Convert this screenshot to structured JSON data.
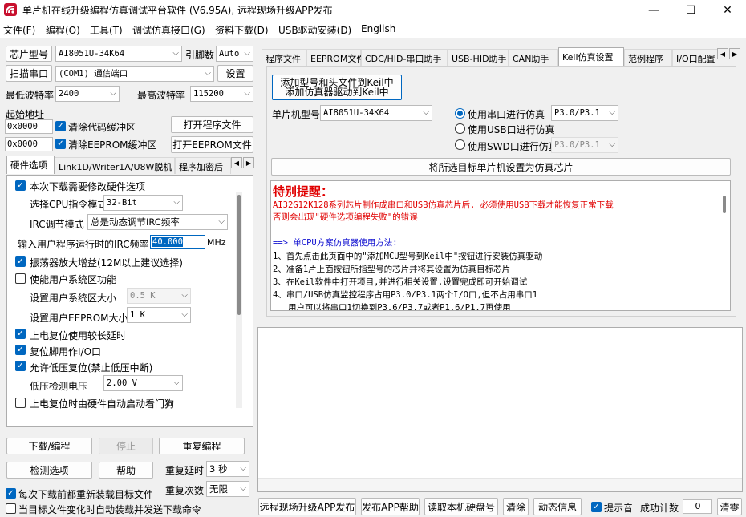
{
  "window": {
    "title": "单片机在线升级编程仿真调试平台软件 (V6.95A), 远程现场升级APP发布",
    "min": "—",
    "max": "☐",
    "close": "✕"
  },
  "menu": [
    "文件(F)",
    "编程(O)",
    "工具(T)",
    "调试仿真接口(G)",
    "资料下载(D)",
    "USB驱动安装(D)",
    "English"
  ],
  "left": {
    "chip_label": "芯片型号",
    "chip_value": "AI8051U-34K64",
    "lead_label": "引脚数",
    "lead_value": "Auto",
    "scan_button": "扫描串口",
    "port_value": "(COM1) 通信端口",
    "settings_button": "设置",
    "min_baud_label": "最低波特率",
    "min_baud_value": "2400",
    "max_baud_label": "最高波特率",
    "max_baud_value": "115200",
    "start_addr_label": "起始地址",
    "addr1": "0x0000",
    "addr2": "0x0000",
    "clear_code_label": "清除代码缓冲区",
    "clear_eeprom_label": "清除EEPROM缓冲区",
    "open_prog_button": "打开程序文件",
    "open_eeprom_button": "打开EEPROM文件",
    "tabs": [
      "硬件选项",
      "Link1D/Writer1A/U8W脱机",
      "程序加密后"
    ],
    "hw": {
      "opt1": "本次下载需要修改硬件选项",
      "cpu_mode_label": "选择CPU指令模式",
      "cpu_mode_value": "32-Bit",
      "irc_mode_label": "IRC调节模式",
      "irc_mode_value": "总是动态调节IRC频率",
      "irc_freq_label": "输入用户程序运行时的IRC频率",
      "irc_freq_value": "40.000",
      "irc_unit": "MHz",
      "opt_osc": "振荡器放大增益(12M以上建议选择)",
      "opt_sysarea": "使能用户系统区功能",
      "sysarea_label": "设置用户系统区大小",
      "sysarea_value": "0.5 K",
      "eeprom_label": "设置用户EEPROM大小",
      "eeprom_value": "1   K",
      "opt_delay": "上电复位使用较长延时",
      "opt_reset_io": "复位脚用作I/O口",
      "opt_lvr": "允许低压复位(禁止低压中断)",
      "lvr_label": "低压检测电压",
      "lvr_value": "2.00 V",
      "opt_wdt": "上电复位时由硬件自动启动看门狗"
    },
    "download_button": "下载/编程",
    "stop_button": "停止",
    "reprog_button": "重复编程",
    "detect_button": "检测选项",
    "help_button": "帮助",
    "repeat_delay_label": "重复延时",
    "repeat_delay_value": "3 秒",
    "repeat_count_label": "重复次数",
    "repeat_count_value": "无限",
    "reload_label": "每次下载前都重新装载目标文件",
    "auto_label": "当目标文件变化时自动装载并发送下载命令"
  },
  "right": {
    "tabs": [
      "程序文件",
      "EEPROM文件",
      "CDC/HID-串口助手",
      "USB-HID助手",
      "CAN助手",
      "Keil仿真设置",
      "范例程序",
      "I/O口配置"
    ],
    "add_keil_line1": "添加型号和头文件到Keil中",
    "add_keil_line2": "添加仿真器驱动到Keil中",
    "mcu_label": "单片机型号",
    "mcu_value": "AI8051U-34K64",
    "radio1": "使用串口进行仿真",
    "radio1_value": "P3.0/P3.1",
    "radio2": "使用USB口进行仿真",
    "radio3": "使用SWD口进行仿真",
    "radio3_value": "P3.0/P3.1",
    "set_chip_button": "将所选目标单片机设置为仿真芯片",
    "notice_title": "特别提醒：",
    "notice_lines": [
      "AI32G12K128系列芯片制作成串口和USB仿真芯片后, 必须使用USB下载才能恢复正常下载",
      "否则会出现\"硬件选项编程失败\"的错误"
    ],
    "usage_title": "==> 单CPU方案仿真器使用方法:",
    "usage_lines": [
      "1、首先点击此页面中的\"添加MCU型号到Keil中\"按钮进行安装仿真驱动",
      "2、准备1片上面按钮所指型号的芯片并将其设置为仿真目标芯片",
      "3、在Keil软件中打开项目,并进行相关设置,设置完成即可开始调试",
      "4、串口/USB仿真监控程序占用P3.0/P3.1两个I/O口,但不占用串口1",
      "   用户可以将串口1切换到P3.6/P3.7或者P1.6/P1.7再使用"
    ]
  },
  "bottom": {
    "remote_button": "远程现场升级APP发布",
    "publish_help_button": "发布APP帮助",
    "read_disk_button": "读取本机硬盘号",
    "clear_button": "清除",
    "dynamic_button": "动态信息",
    "sound_label": "提示音",
    "count_label": "成功计数",
    "count_value": "0",
    "reset_count_button": "清零"
  }
}
